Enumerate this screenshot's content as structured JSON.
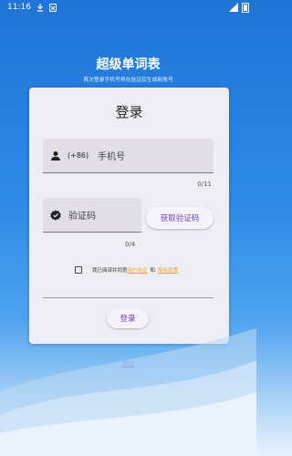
{
  "status_bar": {
    "time": "11:16"
  },
  "app": {
    "title": "超级单词表",
    "subtitle": "首次登录手机号将在验证后生成新账号"
  },
  "login_card": {
    "title": "登录",
    "phone_prefix": "(+86)",
    "phone_placeholder": "手机号",
    "phone_counter": "0/11",
    "code_placeholder": "验证码",
    "code_counter": "0/4",
    "get_code_label": "获取验证码",
    "agreement_text": "我已阅读并同意",
    "user_agreement": "用户协议",
    "and": "和",
    "privacy_policy": "隐私政策",
    "login_label": "登录"
  },
  "skip_label": "跳过",
  "icons": {
    "phone_field": "person-icon",
    "code_field": "verified-icon"
  },
  "colors": {
    "accent": "#6a3fb8",
    "link": "#e9a31a",
    "background_top": "#1f74d6"
  }
}
